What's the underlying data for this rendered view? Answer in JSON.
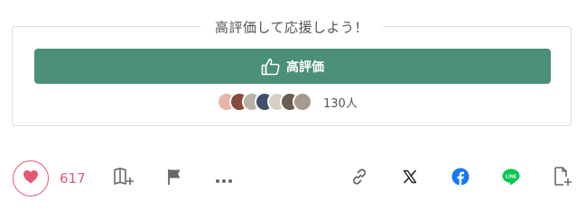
{
  "support": {
    "heading": "高評価して応援しよう！",
    "button_label": "高評価",
    "supporter_count": "130人",
    "avatars": [
      "#e8b4a8",
      "#8a4b3a",
      "#b9b2a7",
      "#3f5068",
      "#d8d0c6",
      "#6b5d52",
      "#a89a8c"
    ]
  },
  "actions": {
    "like_count": "617"
  },
  "icons": {
    "like": "heart-icon",
    "magazine_add": "magazine-add-icon",
    "report": "flag-icon",
    "more": "more-dots-icon",
    "copy_link": "link-icon",
    "share_x": "x-icon",
    "share_facebook": "facebook-icon",
    "share_line": "line-icon",
    "add_note": "add-document-icon"
  },
  "colors": {
    "accent_green": "#4a8f77",
    "like_pink": "#e05a72",
    "facebook_blue": "#1877f2",
    "line_green": "#06c755"
  }
}
